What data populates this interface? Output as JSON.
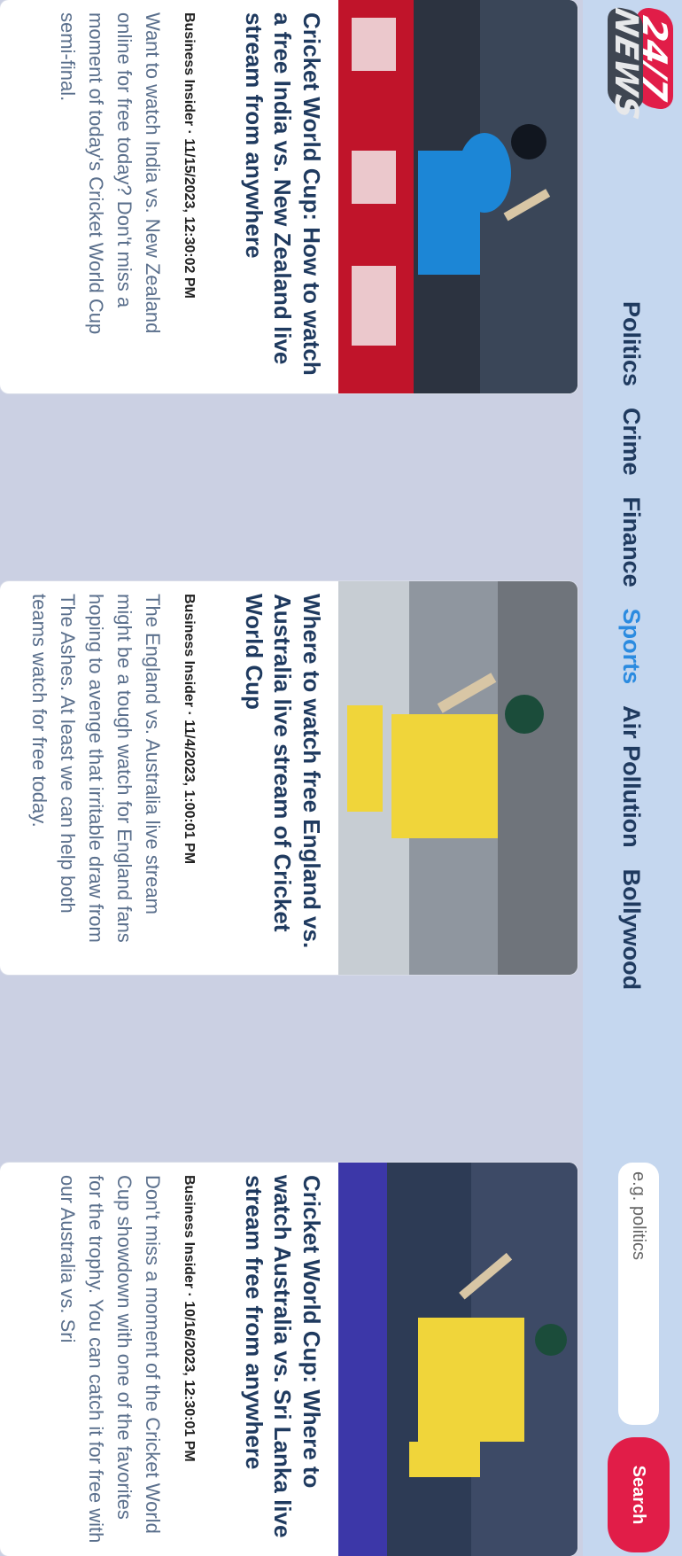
{
  "brand": {
    "logo_top": "24/7",
    "logo_bottom": "NEWS"
  },
  "nav": {
    "items": [
      {
        "label": "Politics",
        "active": false
      },
      {
        "label": "Crime",
        "active": false
      },
      {
        "label": "Finance",
        "active": false
      },
      {
        "label": "Sports",
        "active": true
      },
      {
        "label": "Air Pollution",
        "active": false
      },
      {
        "label": "Bollywood",
        "active": false
      }
    ],
    "search_placeholder": "e.g. politics",
    "search_button": "Search"
  },
  "articles": [
    {
      "title": "Cricket World Cup: How to watch a free India vs. New Zealand live stream from anywhere",
      "source": "Business Insider · 11/15/2023, 12:30:02 PM",
      "description": "Want to watch India vs. New Zealand online for free today? Don't miss a moment of today's Cricket World Cup semi-final."
    },
    {
      "title": "Where to watch free England vs. Australia live stream of Cricket World Cup",
      "source": "Business Insider · 11/4/2023, 1:00:01 PM",
      "description": "The England vs. Australia live stream might be a tough watch for England fans hoping to avenge that irritable draw from The Ashes. At least we can help both teams watch for free today."
    },
    {
      "title": "Cricket World Cup: Where to watch Australia vs. Sri Lanka live stream free from anywhere",
      "source": "Business Insider · 10/16/2023, 12:30:01 PM",
      "description": "Don't miss a moment of the Cricket World Cup showdown with one of the favorites for the trophy. You can catch it for free with our Australia vs. Sri"
    }
  ],
  "colors": {
    "accent": "#e11d48",
    "active_nav": "#2b8be0",
    "nav_bg": "#c5d7ef",
    "page_bg": "#cbd0e3",
    "title": "#1f3a5f"
  }
}
